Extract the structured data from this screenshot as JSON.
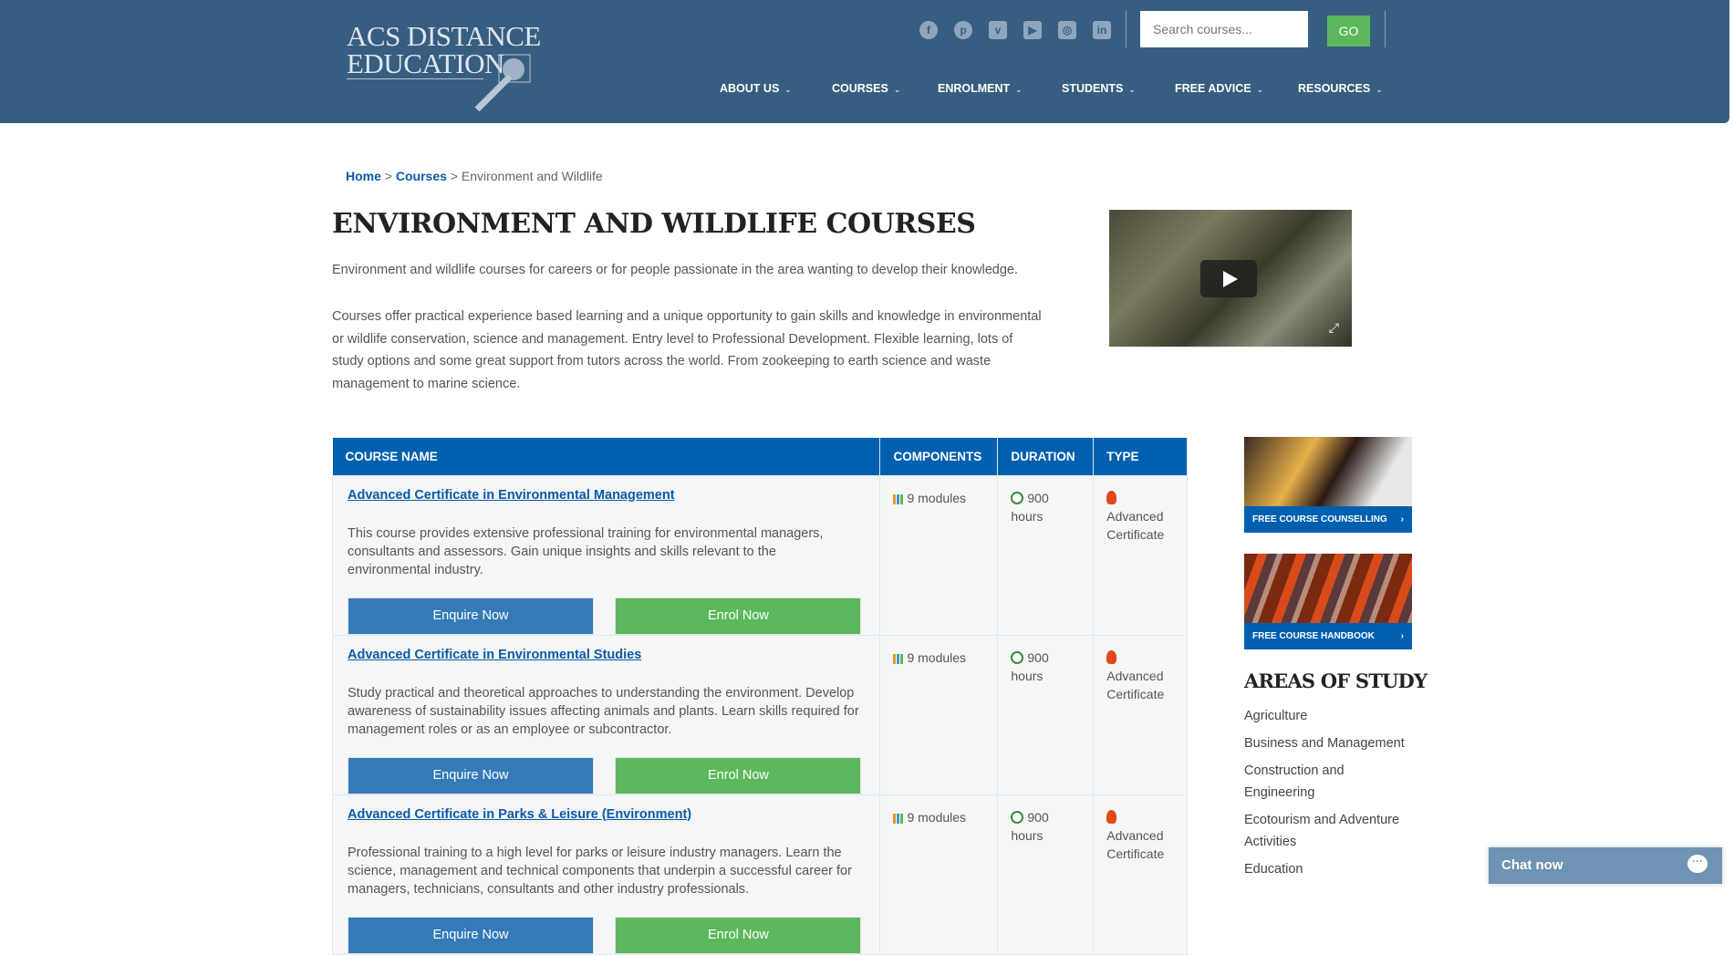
{
  "header": {
    "logo_line1": "ACS DISTANCE",
    "logo_line2": "EDUCATION",
    "social": [
      {
        "icon": "facebook-icon",
        "glyph": "f"
      },
      {
        "icon": "pinterest-icon",
        "glyph": "p"
      },
      {
        "icon": "vimeo-icon",
        "glyph": "v"
      },
      {
        "icon": "youtube-icon",
        "glyph": "▶"
      },
      {
        "icon": "instagram-icon",
        "glyph": "◎"
      },
      {
        "icon": "linkedin-icon",
        "glyph": "in"
      }
    ],
    "search_placeholder": "Search courses...",
    "go_label": "GO",
    "nav": [
      "ABOUT US",
      "COURSES",
      "ENROLMENT",
      "STUDENTS",
      "FREE ADVICE",
      "RESOURCES"
    ],
    "bg_color": "#375e80"
  },
  "breadcrumb": {
    "home": "Home",
    "courses": "Courses",
    "current": "Environment and Wildlife",
    "sep": ">"
  },
  "page": {
    "title": "ENVIRONMENT AND WILDLIFE COURSES",
    "intro": "Environment and wildlife courses for careers or for people passionate in the area wanting to develop their knowledge.",
    "body": "Courses offer practical experience based learning and a unique opportunity to gain skills and knowledge in environmental or wildlife conservation, science and management. Entry level to Professional Development. Flexible learning, lots of study options and some great support from tutors across the world. From zookeeping to earth science and waste management to marine science."
  },
  "table": {
    "headers": [
      "COURSE NAME",
      "COMPONENTS",
      "DURATION",
      "TYPE"
    ],
    "enquire_label": "Enquire Now",
    "enrol_label": "Enrol Now",
    "rows": [
      {
        "name": "Advanced Certificate in Environmental Management",
        "desc": "This course provides extensive professional training for environmental managers, consultants and assessors. Gain unique insights and skills relevant to the environmental industry.",
        "components": "9 modules",
        "duration": "900 hours",
        "type": "Advanced Certificate"
      },
      {
        "name": "Advanced Certificate in Environmental Studies",
        "desc": "Study practical and theoretical approaches to understanding the environment. Develop awareness of sustainability issues affecting animals and plants. Learn skills required for management roles or as an employee or subcontractor.",
        "components": "9 modules",
        "duration": "900 hours",
        "type": "Advanced Certificate"
      },
      {
        "name": "Advanced Certificate in Parks & Leisure (Environment)",
        "desc": "Professional training to a high level for parks or leisure industry managers. Learn the science, management and technical components that underpin a successful career for managers, technicians, consultants and other industry professionals.",
        "components": "9 modules",
        "duration": "900 hours",
        "type": "Advanced Certificate"
      }
    ]
  },
  "sidebar": {
    "banner1": "FREE COURSE COUNSELLING",
    "banner2": "FREE COURSE HANDBOOK",
    "areas_title": "AREAS OF STUDY",
    "areas": [
      "Agriculture",
      "Business and Management",
      "Construction and Engineering",
      "Ecotourism and Adventure Activities",
      "Education"
    ]
  },
  "chat": {
    "label": "Chat now"
  }
}
